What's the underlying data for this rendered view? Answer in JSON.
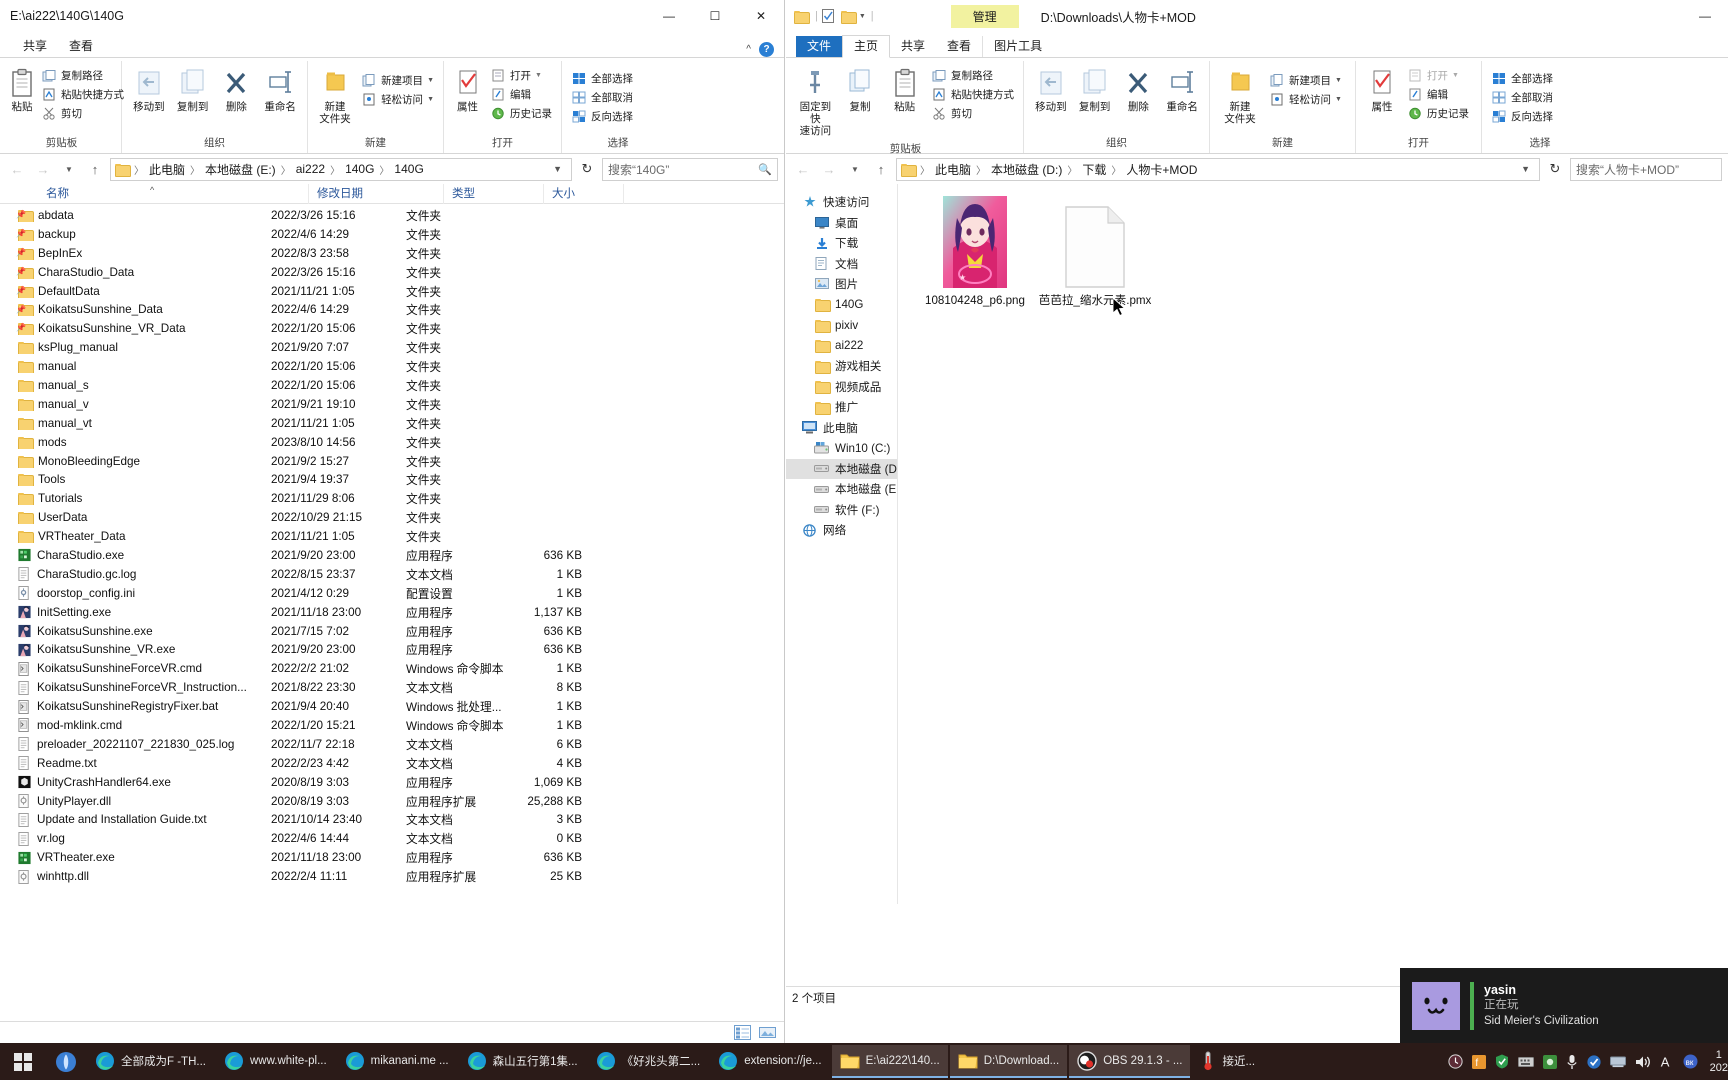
{
  "left_window": {
    "title": "E:\\ai222\\140G\\140G",
    "window_buttons": {
      "minimize": "—",
      "maximize": "☐",
      "close": "✕"
    },
    "tabs": [
      {
        "label": "共享"
      },
      {
        "label": "查看"
      }
    ],
    "ribbon": {
      "groups": [
        {
          "label": "剪贴板",
          "big": [
            {
              "label": "粘贴",
              "icon": "clipboard-icon"
            }
          ],
          "small": [
            {
              "label": "复制路径",
              "icon": "copy-path-icon",
              "disabled": false
            },
            {
              "label": "粘贴快捷方式",
              "icon": "paste-shortcut-icon",
              "disabled": false
            },
            {
              "label": "剪切",
              "icon": "scissors-icon",
              "disabled": false
            }
          ]
        },
        {
          "label": "组织",
          "big": [
            {
              "label": "移动到",
              "icon": "move-to-icon"
            },
            {
              "label": "复制到",
              "icon": "copy-to-icon"
            },
            {
              "label": "删除",
              "icon": "delete-icon"
            },
            {
              "label": "重命名",
              "icon": "rename-icon"
            }
          ],
          "small": []
        },
        {
          "label": "新建",
          "big": [
            {
              "label": "新建\n文件夹",
              "icon": "new-folder-icon"
            }
          ],
          "small": [
            {
              "label": "新建项目",
              "icon": "new-item-icon"
            },
            {
              "label": "轻松访问",
              "icon": "easy-access-icon"
            }
          ]
        },
        {
          "label": "打开",
          "big": [
            {
              "label": "属性",
              "icon": "properties-icon"
            }
          ],
          "small": [
            {
              "label": "打开",
              "icon": "open-icon"
            },
            {
              "label": "编辑",
              "icon": "edit-icon"
            },
            {
              "label": "历史记录",
              "icon": "history-icon"
            }
          ]
        },
        {
          "label": "选择",
          "big": [],
          "small": [
            {
              "label": "全部选择",
              "icon": "select-all-icon"
            },
            {
              "label": "全部取消",
              "icon": "select-none-icon"
            },
            {
              "label": "反向选择",
              "icon": "invert-selection-icon"
            }
          ]
        }
      ]
    },
    "address": {
      "crumbs": [
        "此电脑",
        "本地磁盘 (E:)",
        "ai222",
        "140G",
        "140G"
      ],
      "refresh_icon": "refresh-icon",
      "search_placeholder": "搜索“140G”"
    },
    "columns": [
      {
        "label": "名称",
        "key": "name"
      },
      {
        "label": "修改日期",
        "key": "date"
      },
      {
        "label": "类型",
        "key": "type"
      },
      {
        "label": "大小",
        "key": "size"
      }
    ],
    "files": [
      {
        "name": "abdata",
        "date": "2022/3/26 15:16",
        "type": "文件夹",
        "size": "",
        "icon": "folder-icon"
      },
      {
        "name": "backup",
        "date": "2022/4/6 14:29",
        "type": "文件夹",
        "size": "",
        "icon": "folder-icon"
      },
      {
        "name": "BepInEx",
        "date": "2022/8/3 23:58",
        "type": "文件夹",
        "size": "",
        "icon": "folder-icon"
      },
      {
        "name": "CharaStudio_Data",
        "date": "2022/3/26 15:16",
        "type": "文件夹",
        "size": "",
        "icon": "folder-icon"
      },
      {
        "name": "DefaultData",
        "date": "2021/11/21 1:05",
        "type": "文件夹",
        "size": "",
        "icon": "folder-icon"
      },
      {
        "name": "KoikatsuSunshine_Data",
        "date": "2022/4/6 14:29",
        "type": "文件夹",
        "size": "",
        "icon": "folder-icon"
      },
      {
        "name": "KoikatsuSunshine_VR_Data",
        "date": "2022/1/20 15:06",
        "type": "文件夹",
        "size": "",
        "icon": "folder-icon"
      },
      {
        "name": "ksPlug_manual",
        "date": "2021/9/20 7:07",
        "type": "文件夹",
        "size": "",
        "icon": "folder-icon"
      },
      {
        "name": "manual",
        "date": "2022/1/20 15:06",
        "type": "文件夹",
        "size": "",
        "icon": "folder-icon"
      },
      {
        "name": "manual_s",
        "date": "2022/1/20 15:06",
        "type": "文件夹",
        "size": "",
        "icon": "folder-icon"
      },
      {
        "name": "manual_v",
        "date": "2021/9/21 19:10",
        "type": "文件夹",
        "size": "",
        "icon": "folder-icon"
      },
      {
        "name": "manual_vt",
        "date": "2021/11/21 1:05",
        "type": "文件夹",
        "size": "",
        "icon": "folder-icon"
      },
      {
        "name": "mods",
        "date": "2023/8/10 14:56",
        "type": "文件夹",
        "size": "",
        "icon": "folder-icon"
      },
      {
        "name": "MonoBleedingEdge",
        "date": "2021/9/2 15:27",
        "type": "文件夹",
        "size": "",
        "icon": "folder-icon"
      },
      {
        "name": "Tools",
        "date": "2021/9/4 19:37",
        "type": "文件夹",
        "size": "",
        "icon": "folder-icon"
      },
      {
        "name": "Tutorials",
        "date": "2021/11/29 8:06",
        "type": "文件夹",
        "size": "",
        "icon": "folder-icon"
      },
      {
        "name": "UserData",
        "date": "2022/10/29 21:15",
        "type": "文件夹",
        "size": "",
        "icon": "folder-icon"
      },
      {
        "name": "VRTheater_Data",
        "date": "2021/11/21 1:05",
        "type": "文件夹",
        "size": "",
        "icon": "folder-icon"
      },
      {
        "name": "CharaStudio.exe",
        "date": "2021/9/20 23:00",
        "type": "应用程序",
        "size": "636 KB",
        "icon": "exe-green-icon"
      },
      {
        "name": "CharaStudio.gc.log",
        "date": "2022/8/15 23:37",
        "type": "文本文档",
        "size": "1 KB",
        "icon": "text-file-icon"
      },
      {
        "name": "doorstop_config.ini",
        "date": "2021/4/12 0:29",
        "type": "配置设置",
        "size": "1 KB",
        "icon": "ini-file-icon"
      },
      {
        "name": "InitSetting.exe",
        "date": "2021/11/18 23:00",
        "type": "应用程序",
        "size": "1,137 KB",
        "icon": "exe-anime-icon"
      },
      {
        "name": "KoikatsuSunshine.exe",
        "date": "2021/7/15 7:02",
        "type": "应用程序",
        "size": "636 KB",
        "icon": "exe-anime-icon"
      },
      {
        "name": "KoikatsuSunshine_VR.exe",
        "date": "2021/9/20 23:00",
        "type": "应用程序",
        "size": "636 KB",
        "icon": "exe-anime-icon"
      },
      {
        "name": "KoikatsuSunshineForceVR.cmd",
        "date": "2022/2/2 21:02",
        "type": "Windows 命令脚本",
        "size": "1 KB",
        "icon": "cmd-file-icon"
      },
      {
        "name": "KoikatsuSunshineForceVR_Instruction...",
        "date": "2021/8/22 23:30",
        "type": "文本文档",
        "size": "8 KB",
        "icon": "text-file-icon"
      },
      {
        "name": "KoikatsuSunshineRegistryFixer.bat",
        "date": "2021/9/4 20:40",
        "type": "Windows 批处理...",
        "size": "1 KB",
        "icon": "cmd-file-icon"
      },
      {
        "name": "mod-mklink.cmd",
        "date": "2022/1/20 15:21",
        "type": "Windows 命令脚本",
        "size": "1 KB",
        "icon": "cmd-file-icon"
      },
      {
        "name": "preloader_20221107_221830_025.log",
        "date": "2022/11/7 22:18",
        "type": "文本文档",
        "size": "6 KB",
        "icon": "text-file-icon"
      },
      {
        "name": "Readme.txt",
        "date": "2022/2/23 4:42",
        "type": "文本文档",
        "size": "4 KB",
        "icon": "text-file-icon"
      },
      {
        "name": "UnityCrashHandler64.exe",
        "date": "2020/8/19 3:03",
        "type": "应用程序",
        "size": "1,069 KB",
        "icon": "exe-unity-icon"
      },
      {
        "name": "UnityPlayer.dll",
        "date": "2020/8/19 3:03",
        "type": "应用程序扩展",
        "size": "25,288 KB",
        "icon": "dll-file-icon"
      },
      {
        "name": "Update and Installation Guide.txt",
        "date": "2021/10/14 23:40",
        "type": "文本文档",
        "size": "3 KB",
        "icon": "text-file-icon"
      },
      {
        "name": "vr.log",
        "date": "2022/4/6 14:44",
        "type": "文本文档",
        "size": "0 KB",
        "icon": "text-file-icon"
      },
      {
        "name": "VRTheater.exe",
        "date": "2021/11/18 23:00",
        "type": "应用程序",
        "size": "636 KB",
        "icon": "exe-green-icon"
      },
      {
        "name": "winhttp.dll",
        "date": "2022/2/4 11:11",
        "type": "应用程序扩展",
        "size": "25 KB",
        "icon": "dll-file-icon"
      }
    ],
    "status": {
      "text": "",
      "view_icons": [
        "details-view-icon",
        "large-icons-view-icon"
      ]
    }
  },
  "right_window": {
    "title": "D:\\Downloads\\人物卡+MOD",
    "context_tab_group": "管理",
    "window_buttons": {
      "minimize": "—"
    },
    "tabs": [
      {
        "label": "文件",
        "kind": "file"
      },
      {
        "label": "主页",
        "kind": "active"
      },
      {
        "label": "共享",
        "kind": "normal"
      },
      {
        "label": "查看",
        "kind": "normal"
      },
      {
        "label": "图片工具",
        "kind": "context"
      }
    ],
    "ribbon": {
      "groups": [
        {
          "label": "剪贴板",
          "big": [
            {
              "label": "固定到快\n速访问",
              "icon": "pin-icon"
            },
            {
              "label": "复制",
              "icon": "copy-icon"
            },
            {
              "label": "粘贴",
              "icon": "clipboard-icon"
            }
          ],
          "small": [
            {
              "label": "复制路径",
              "icon": "copy-path-icon"
            },
            {
              "label": "粘贴快捷方式",
              "icon": "paste-shortcut-icon"
            },
            {
              "label": "剪切",
              "icon": "scissors-icon"
            }
          ]
        },
        {
          "label": "组织",
          "big": [
            {
              "label": "移动到",
              "icon": "move-to-icon"
            },
            {
              "label": "复制到",
              "icon": "copy-to-icon"
            },
            {
              "label": "删除",
              "icon": "delete-icon"
            },
            {
              "label": "重命名",
              "icon": "rename-icon"
            }
          ],
          "small": []
        },
        {
          "label": "新建",
          "big": [
            {
              "label": "新建\n文件夹",
              "icon": "new-folder-icon"
            }
          ],
          "small": [
            {
              "label": "新建项目",
              "icon": "new-item-icon"
            },
            {
              "label": "轻松访问",
              "icon": "easy-access-icon"
            }
          ]
        },
        {
          "label": "打开",
          "big": [
            {
              "label": "属性",
              "icon": "properties-icon"
            }
          ],
          "small": [
            {
              "label": "打开",
              "icon": "open-icon"
            },
            {
              "label": "编辑",
              "icon": "edit-icon"
            },
            {
              "label": "历史记录",
              "icon": "history-icon"
            }
          ]
        },
        {
          "label": "选择",
          "big": [],
          "small": [
            {
              "label": "全部选择",
              "icon": "select-all-icon"
            },
            {
              "label": "全部取消",
              "icon": "select-none-icon"
            },
            {
              "label": "反向选择",
              "icon": "invert-selection-icon"
            }
          ]
        }
      ]
    },
    "address": {
      "crumbs": [
        "此电脑",
        "本地磁盘 (D:)",
        "下载",
        "人物卡+MOD"
      ],
      "search_placeholder": "搜索“人物卡+MOD”"
    },
    "nav_pane": [
      {
        "label": "快速访问",
        "icon": "star-pin-icon",
        "indent": false,
        "selected": false,
        "pinned": false
      },
      {
        "label": "桌面",
        "icon": "desktop-icon",
        "indent": true,
        "selected": false,
        "pinned": true
      },
      {
        "label": "下载",
        "icon": "downloads-icon",
        "indent": true,
        "selected": false,
        "pinned": true
      },
      {
        "label": "文档",
        "icon": "documents-icon",
        "indent": true,
        "selected": false,
        "pinned": true
      },
      {
        "label": "图片",
        "icon": "pictures-icon",
        "indent": true,
        "selected": false,
        "pinned": true
      },
      {
        "label": "140G",
        "icon": "folder-icon",
        "indent": true,
        "selected": false,
        "pinned": false
      },
      {
        "label": "pixiv",
        "icon": "folder-icon",
        "indent": true,
        "selected": false,
        "pinned": false
      },
      {
        "label": "ai222",
        "icon": "folder-icon",
        "indent": true,
        "selected": false,
        "pinned": false
      },
      {
        "label": "游戏相关",
        "icon": "folder-icon",
        "indent": true,
        "selected": false,
        "pinned": false
      },
      {
        "label": "视频成品",
        "icon": "folder-icon",
        "indent": true,
        "selected": false,
        "pinned": false
      },
      {
        "label": "推广",
        "icon": "folder-icon",
        "indent": true,
        "selected": false,
        "pinned": false
      },
      {
        "label": "此电脑",
        "icon": "computer-icon",
        "indent": false,
        "selected": false,
        "pinned": false
      },
      {
        "label": "Win10 (C:)",
        "icon": "windows-drive-icon",
        "indent": true,
        "selected": false,
        "pinned": false
      },
      {
        "label": "本地磁盘 (D:)",
        "icon": "drive-icon",
        "indent": true,
        "selected": true,
        "pinned": false
      },
      {
        "label": "本地磁盘 (E:)",
        "icon": "drive-icon",
        "indent": true,
        "selected": false,
        "pinned": false
      },
      {
        "label": "软件 (F:)",
        "icon": "drive-icon",
        "indent": true,
        "selected": false,
        "pinned": false
      },
      {
        "label": "网络",
        "icon": "network-icon",
        "indent": false,
        "selected": false,
        "pinned": false
      }
    ],
    "items": [
      {
        "name": "108104248_p6.png",
        "kind": "image",
        "icon": "image-thumbnail"
      },
      {
        "name": "芭芭拉_缩水元素.pmx",
        "kind": "file",
        "icon": "generic-file-icon"
      }
    ],
    "status": {
      "text": "2 个项目"
    }
  },
  "taskbar": {
    "start_icon": "windows-start-icon",
    "search_icon": "cortana-icon",
    "items": [
      {
        "label": "全部成为F -TH...",
        "icon": "edge-icon",
        "active": false
      },
      {
        "label": "www.white-pl...",
        "icon": "edge-icon",
        "active": false
      },
      {
        "label": "mikanani.me ...",
        "icon": "edge-icon",
        "active": false
      },
      {
        "label": "森山五行第1集...",
        "icon": "edge-icon",
        "active": false
      },
      {
        "label": "《好兆头第二...",
        "icon": "edge-icon",
        "active": false
      },
      {
        "label": "extension://je...",
        "icon": "edge-icon",
        "active": false
      },
      {
        "label": "E:\\ai222\\140...",
        "icon": "explorer-icon",
        "active": true
      },
      {
        "label": "D:\\Download...",
        "icon": "explorer-icon",
        "active": true
      },
      {
        "label": "OBS 29.1.3 - ...",
        "icon": "obs-icon",
        "active": true
      },
      {
        "label": "接近...",
        "icon": "weather-icon",
        "active": false
      }
    ],
    "tray_icons": [
      "clock-tray-icon",
      "orange-tray-icon",
      "shield-tray-icon",
      "keyboard-tray-icon",
      "green-tray-icon",
      "mic-tray-icon",
      "check-tray-icon",
      "network-tray-icon",
      "volume-tray-icon",
      "ime-A-tray-icon",
      "blue-circle-tray-icon"
    ],
    "clock": {
      "time": "1",
      "date": "202"
    }
  },
  "overlay_widget": {
    "avatar": "cat-face-avatar",
    "name": "yasin",
    "status": "正在玩",
    "game": "Sid Meier's Civilization"
  }
}
